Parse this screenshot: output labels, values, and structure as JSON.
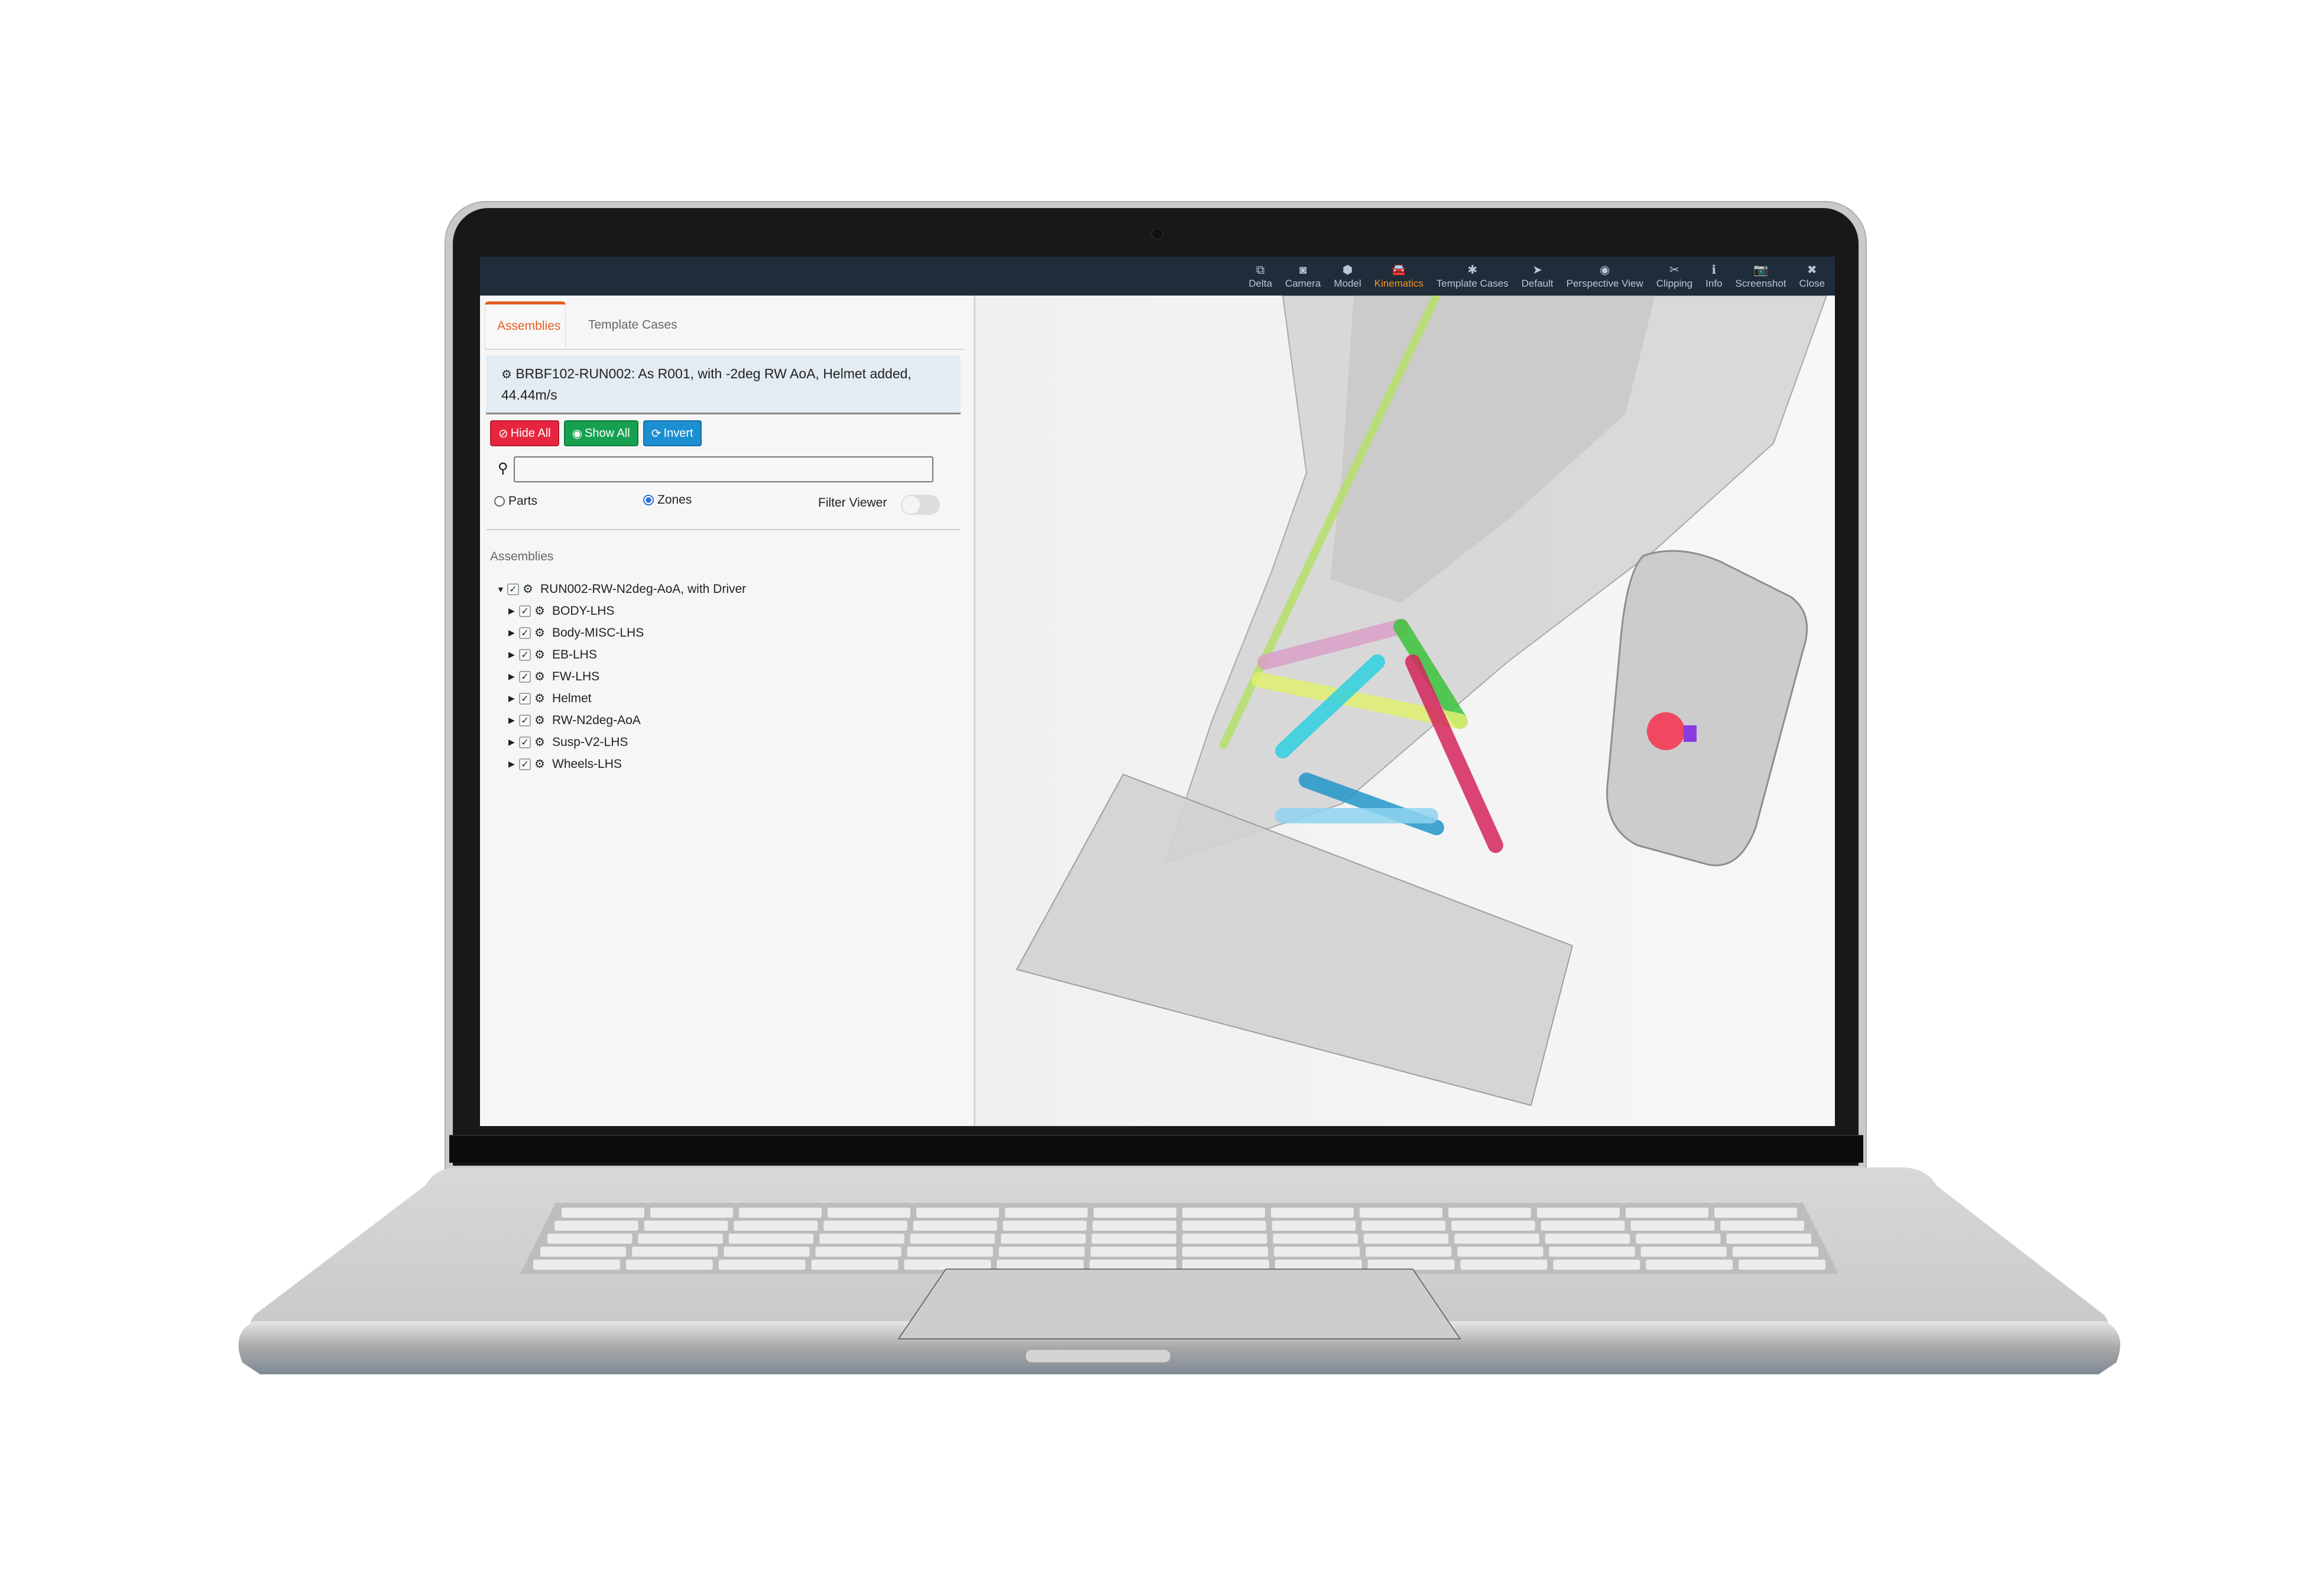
{
  "toolbar": {
    "items": [
      {
        "icon": "delta-icon",
        "glyph": "⧉",
        "label": "Delta",
        "active": false
      },
      {
        "icon": "camera-icon",
        "glyph": "◙",
        "label": "Camera",
        "active": false
      },
      {
        "icon": "cube-icon",
        "glyph": "⬢",
        "label": "Model",
        "active": false
      },
      {
        "icon": "car-icon",
        "glyph": "🚘",
        "label": "Kinematics",
        "active": true
      },
      {
        "icon": "gear-icon",
        "glyph": "✱",
        "label": "Template Cases",
        "active": false
      },
      {
        "icon": "location-arrow-icon",
        "glyph": "➤",
        "label": "Default",
        "active": false
      },
      {
        "icon": "eye-icon",
        "glyph": "◉",
        "label": "Perspective View",
        "active": false
      },
      {
        "icon": "scissors-icon",
        "glyph": "✂",
        "label": "Clipping",
        "active": false
      },
      {
        "icon": "info-icon",
        "glyph": "ℹ",
        "label": "Info",
        "active": false
      },
      {
        "icon": "camera-photo-icon",
        "glyph": "📷",
        "label": "Screenshot",
        "active": false
      },
      {
        "icon": "close-icon",
        "glyph": "✖",
        "label": "Close",
        "active": false
      }
    ],
    "accent_color": "#f7931e"
  },
  "panel": {
    "tabs": {
      "active": "Assemblies",
      "inactive": "Template Cases"
    },
    "case_description": "BRBF102-RUN002: As R001, with -2deg RW AoA, Helmet added, 44.44m/s",
    "buttons": {
      "hide_all": "Hide All",
      "show_all": "Show All",
      "invert": "Invert"
    },
    "search": {
      "value": "",
      "placeholder": ""
    },
    "radio": {
      "parts": "Parts",
      "zones": "Zones",
      "selected": "Zones"
    },
    "filter_viewer": {
      "label": "Filter Viewer",
      "on": false
    },
    "assemblies_title": "Assemblies",
    "tree": {
      "root": {
        "label": "RUN002-RW-N2deg-AoA, with Driver",
        "expanded": true,
        "checked": true
      },
      "children": [
        {
          "label": "BODY-LHS",
          "checked": true
        },
        {
          "label": "Body-MISC-LHS",
          "checked": true
        },
        {
          "label": "EB-LHS",
          "checked": true
        },
        {
          "label": "FW-LHS",
          "checked": true
        },
        {
          "label": "Helmet",
          "checked": true
        },
        {
          "label": "RW-N2deg-AoA",
          "checked": true
        },
        {
          "label": "Susp-V2-LHS",
          "checked": true
        },
        {
          "label": "Wheels-LHS",
          "checked": true
        }
      ]
    }
  },
  "viewport": {
    "description": "3D transparent race car model with colored suspension links",
    "link_colors": [
      "#b5e06a",
      "#d9a0c8",
      "#3cc23c",
      "#e0f070",
      "#d4245c",
      "#2fd0e0",
      "#2196c8",
      "#8fd4f0"
    ],
    "marker_colors": {
      "ball": "#f04860",
      "stub": "#8a3ce0"
    }
  }
}
